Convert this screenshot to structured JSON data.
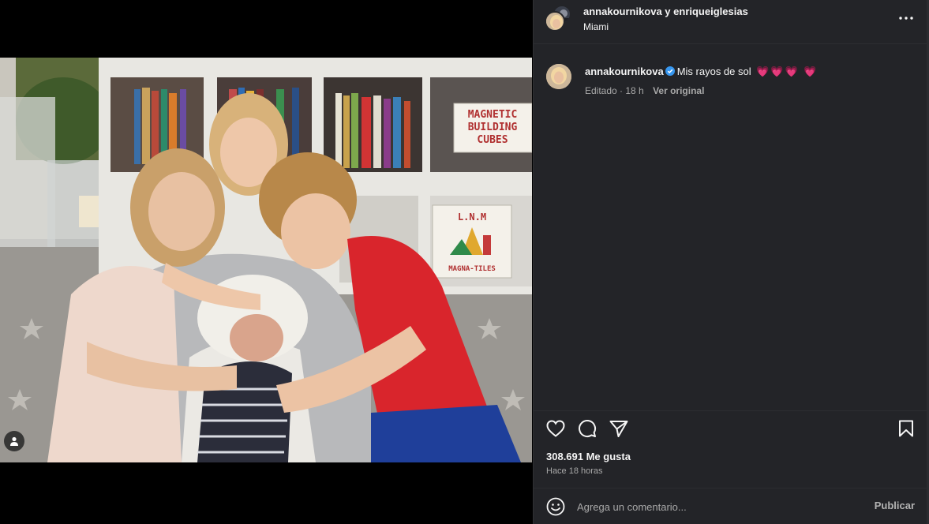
{
  "post": {
    "header_names": "annakournikova y enriqueiglesias",
    "location": "Miami",
    "caption_user": "annakournikova",
    "caption_text": "Mis rayos de sol",
    "caption_hearts": "💗💗💗 💗",
    "edited_label": "Editado · 18 h",
    "see_original": "Ver original",
    "likes": "308.691 Me gusta",
    "time_ago": "Hace 18 horas"
  },
  "photo_signs": {
    "magnetic_1": "MAGNETIC",
    "magnetic_2": "BUILDING",
    "magnetic_3": "CUBES",
    "lnm": "L.N.M",
    "magna": "MAGNA-TILES"
  },
  "comment": {
    "placeholder": "Agrega un comentario...",
    "publish_label": "Publicar"
  },
  "icons": {
    "more": "more-options-icon",
    "like": "heart-icon",
    "comment": "comment-icon",
    "share": "send-icon",
    "save": "bookmark-icon",
    "emoji": "emoji-icon",
    "tag": "user-tag-icon",
    "verified": "verified-badge-icon"
  },
  "colors": {
    "panel_bg": "#232428",
    "verified": "#3797f0",
    "heart": "#ff4d7a"
  }
}
